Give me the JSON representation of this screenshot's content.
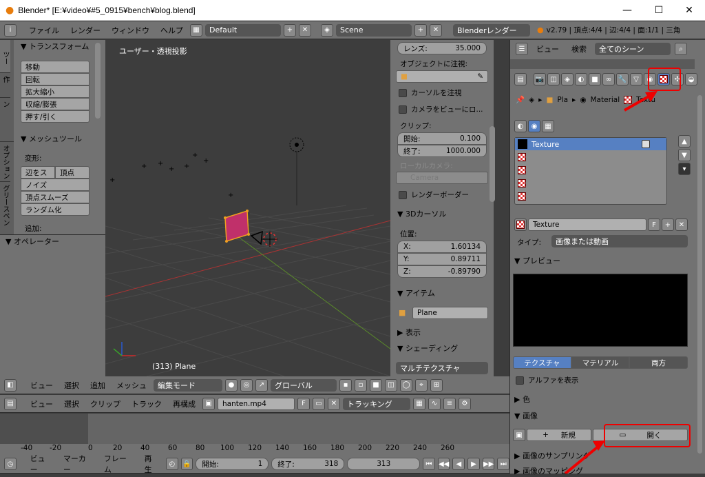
{
  "window": {
    "title": "Blender* [E:¥video¥#5_0915¥bench¥blog.blend]",
    "minimize": "—",
    "maximize": "☐",
    "close": "✕"
  },
  "topbar": {
    "menus": [
      "ファイル",
      "レンダー",
      "ウィンドウ",
      "ヘルプ"
    ],
    "layout": "Default",
    "scene": "Scene",
    "engine": "Blenderレンダー",
    "stats": "v2.79 | 頂点:4/4 | 辺:4/4 | 面:1/1 | 三角"
  },
  "toolshelf": {
    "tabs": [
      "ツー",
      "作",
      "シェーディン",
      "オプション",
      "グリースペン"
    ],
    "transform_title": "▼ トランスフォーム",
    "transform_buttons": [
      "移動",
      "回転",
      "拡大縮小",
      "収縮/膨張",
      "押す/引く"
    ],
    "mesh_title": "▼ メッシュツール",
    "deform_label": "変形:",
    "deform_row": [
      "辺をス",
      "頂点"
    ],
    "deform_buttons": [
      "ノイズ",
      "頂点スムーズ",
      "ランダム化"
    ],
    "add_label": "追加:",
    "operator_title": "▼ オペレーター"
  },
  "viewport": {
    "label": "ユーザー・透視投影",
    "object": "(313) Plane"
  },
  "npanel": {
    "lens_label": "レンズ:",
    "lens_value": "35.000",
    "focus_label": "オブジェクトに注視:",
    "cursor_check": "カーソルを注視",
    "camera_check": "カメラをビューにロ...",
    "clip_label": "クリップ:",
    "clip_start_label": "開始:",
    "clip_start": "0.100",
    "clip_end_label": "終了:",
    "clip_end": "1000.000",
    "local_cam_label": "ローカルカメラ:",
    "local_cam_value": "Camera",
    "render_border": "レンダーボーダー",
    "cursor_title": "▼ 3Dカーソル",
    "pos_label": "位置:",
    "x_label": "X:",
    "x": "1.60134",
    "y_label": "Y:",
    "y": "0.89711",
    "z_label": "Z:",
    "z": "-0.89790",
    "item_title": "▼ アイテム",
    "item_name": "Plane",
    "display_title": "▶ 表示",
    "shading_title": "▼ シェーディング",
    "shading_mode": "マルチテクスチャ"
  },
  "view3d_header": {
    "menus": [
      "ビュー",
      "選択",
      "追加",
      "メッシュ"
    ],
    "mode": "編集モード",
    "orientation": "グローバル"
  },
  "clip_header": {
    "menus": [
      "ビュー",
      "選択",
      "クリップ",
      "トラック",
      "再構成"
    ],
    "clip_name": "hanten.mp4",
    "f_label": "F",
    "tracking": "トラッキング"
  },
  "timeline": {
    "ticks": [
      "-40",
      "-20",
      "0",
      "20",
      "40",
      "60",
      "80",
      "100",
      "120",
      "140",
      "160",
      "180",
      "200",
      "220",
      "240",
      "260"
    ]
  },
  "bottombar": {
    "menus": [
      "ビュー",
      "マーカー",
      "フレーム",
      "再生"
    ],
    "start_label": "開始:",
    "start": "1",
    "end_label": "終了:",
    "end": "318",
    "current": "313"
  },
  "properties": {
    "header_menus": [
      "ビュー",
      "検索"
    ],
    "scene_filter": "全てのシーン",
    "breadcrumb": [
      "Pla",
      "Material",
      "Textu"
    ],
    "texture_slots": [
      "Texture",
      "",
      "",
      "",
      "",
      ""
    ],
    "texture_name": "Texture",
    "f_label": "F",
    "type_label": "タイプ:",
    "type_value": "画像または動画",
    "preview_title": "▼ プレビュー",
    "preview_tabs": [
      "テクスチャ",
      "マテリアル",
      "両方"
    ],
    "alpha_label": "アルファを表示",
    "color_title": "▶ 色",
    "image_title": "▼ 画像",
    "new_label": "新規",
    "open_label": "開く",
    "sampling_title": "▶ 画像のサンプリング",
    "mapping_title": "▶ 画像のマッピング"
  },
  "colors": {
    "accent": "#5680c2",
    "highlight": "#e00000",
    "selected_face": "#c0306a"
  }
}
